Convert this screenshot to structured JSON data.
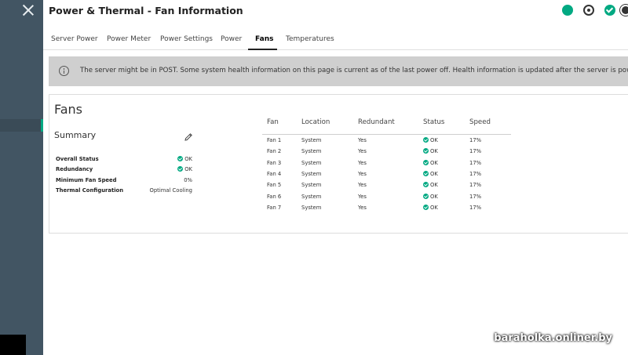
{
  "page": {
    "title": "Power & Thermal - Fan Information"
  },
  "header": {
    "icons": [
      "health-icon",
      "target-icon",
      "check-icon",
      "sun-icon"
    ],
    "colors": {
      "accent": "#01a982",
      "sidebar": "#425563"
    }
  },
  "tabs": [
    {
      "label": "Server Power"
    },
    {
      "label": "Power Meter"
    },
    {
      "label": "Power Settings"
    },
    {
      "label": "Power"
    },
    {
      "label": "Fans",
      "active": true
    },
    {
      "label": "Temperatures"
    }
  ],
  "banner": {
    "message": "The server might be in POST. Some system health information on this page is current as of the last power off. Health information is updated after the server is powered on and"
  },
  "card": {
    "title": "Fans",
    "summary": {
      "title": "Summary",
      "rows": [
        {
          "label": "Overall Status",
          "value": "OK",
          "ok": true
        },
        {
          "label": "Redundancy",
          "value": "OK",
          "ok": true
        },
        {
          "label": "Minimum Fan Speed",
          "value": "0%"
        },
        {
          "label": "Thermal Configuration",
          "value": "Optimal Cooling"
        }
      ]
    },
    "fans": {
      "columns": [
        "Fan",
        "Location",
        "Redundant",
        "Status",
        "Speed"
      ],
      "rows": [
        {
          "fan": "Fan 1",
          "location": "System",
          "redundant": "Yes",
          "status": "OK",
          "speed": "17%"
        },
        {
          "fan": "Fan 2",
          "location": "System",
          "redundant": "Yes",
          "status": "OK",
          "speed": "17%"
        },
        {
          "fan": "Fan 3",
          "location": "System",
          "redundant": "Yes",
          "status": "OK",
          "speed": "17%"
        },
        {
          "fan": "Fan 4",
          "location": "System",
          "redundant": "Yes",
          "status": "OK",
          "speed": "17%"
        },
        {
          "fan": "Fan 5",
          "location": "System",
          "redundant": "Yes",
          "status": "OK",
          "speed": "17%"
        },
        {
          "fan": "Fan 6",
          "location": "System",
          "redundant": "Yes",
          "status": "OK",
          "speed": "17%"
        },
        {
          "fan": "Fan 7",
          "location": "System",
          "redundant": "Yes",
          "status": "OK",
          "speed": "17%"
        }
      ]
    }
  },
  "watermark": "baraholka.onliner.by"
}
